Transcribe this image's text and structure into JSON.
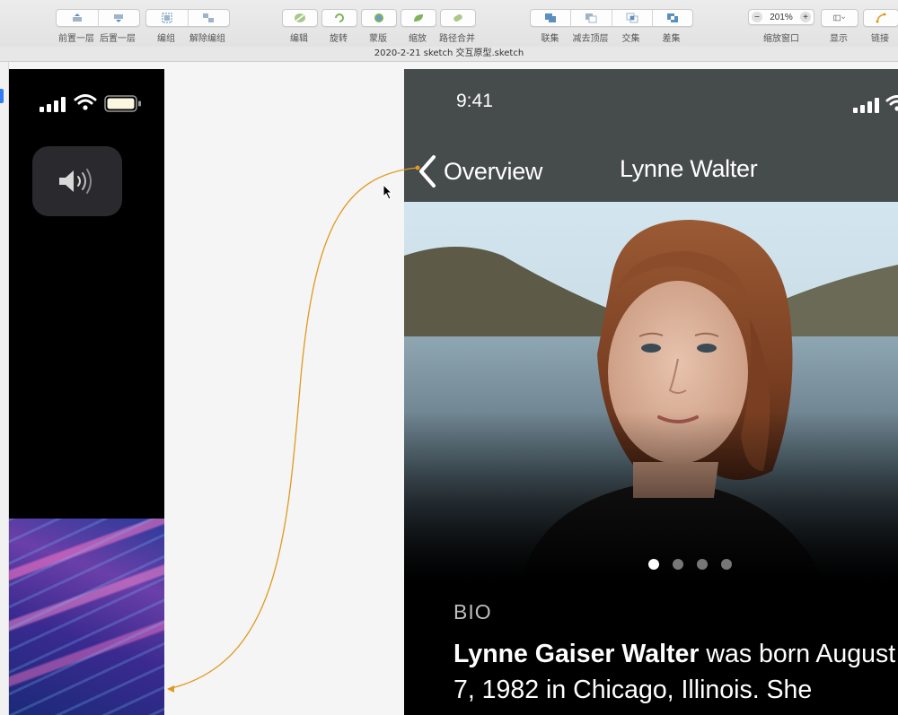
{
  "toolbar": {
    "forward_label": "前置一层",
    "backward_label": "后置一层",
    "group_label": "编组",
    "ungroup_label": "解除编组",
    "edit_label": "编辑",
    "rotate_label": "旋转",
    "mask_label": "蒙版",
    "scale_label": "缩放",
    "flatten_label": "路径合并",
    "union_label": "联集",
    "subtract_label": "减去顶层",
    "intersect_label": "交集",
    "difference_label": "差集",
    "zoom_value": "201%",
    "zoom_minus": "−",
    "zoom_plus": "+",
    "zoom_label": "缩放窗口",
    "view_label": "显示",
    "link_label": "链接"
  },
  "window": {
    "title": "2020-2-21 sketch 交互原型.sketch"
  },
  "right_phone": {
    "time": "9:41",
    "back_label": "Overview",
    "nav_title": "Lynne Walter",
    "bio_heading": "BIO",
    "bio_name": "Lynne Gaiser Walter",
    "bio_line1_rest": " was born August",
    "bio_line2": "7, 1982 in Chicago, Illinois. She",
    "page_count": 4,
    "active_page": 1
  },
  "colors": {
    "navbar": "#464b4b",
    "prototype_link": "#e0991e",
    "accent_blue": "#2f7df6"
  }
}
